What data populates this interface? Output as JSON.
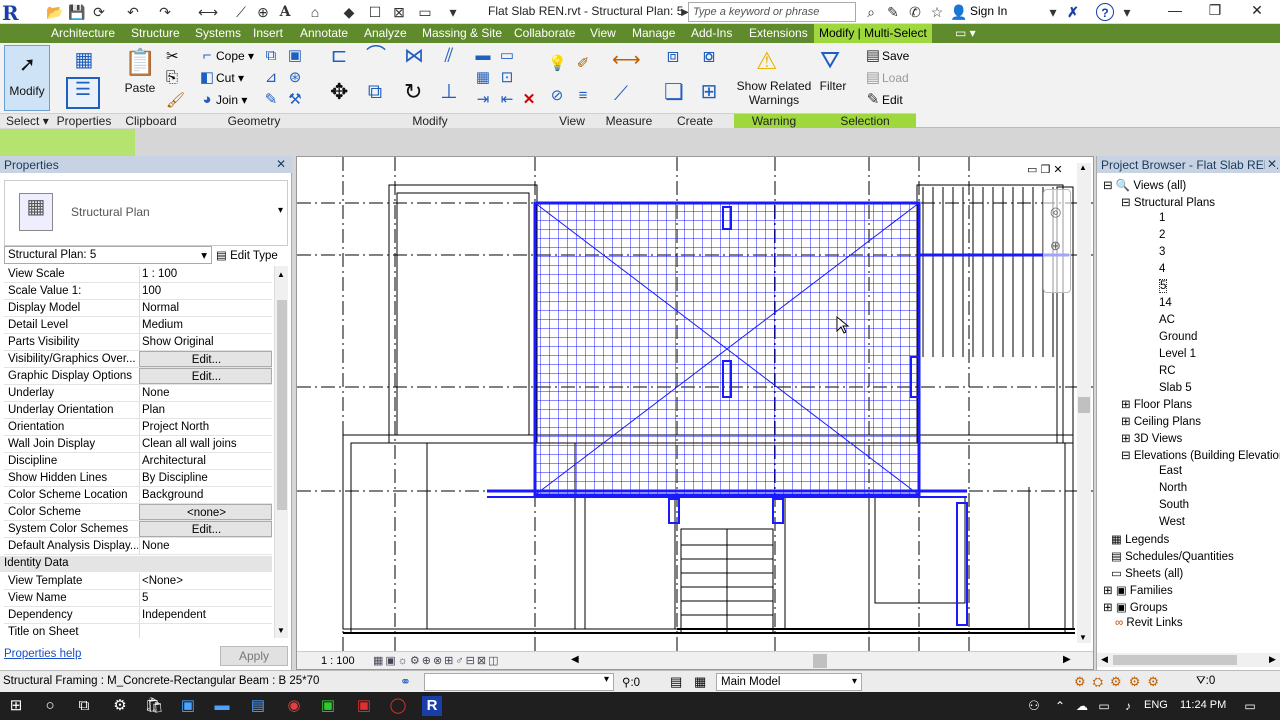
{
  "titlebar": {
    "logo": "R",
    "doc_title": "Flat Slab REN.rvt - Structural Plan: 5",
    "search_placeholder": "Type a keyword or phrase",
    "signin": "Sign In",
    "minimize": "—",
    "restore": "❐",
    "close": "✕",
    "help": "?"
  },
  "tabs": [
    "Architecture",
    "Structure",
    "Systems",
    "Insert",
    "Annotate",
    "Analyze",
    "Massing & Site",
    "Collaborate",
    "View",
    "Manage",
    "Add-Ins",
    "Extensions",
    "Modify | Multi-Select"
  ],
  "ribbon": {
    "modify": "Modify",
    "paste": "Paste",
    "cope": "Cope",
    "cut": "Cut",
    "join": "Join",
    "show_related": "Show Related",
    "warnings": "Warnings",
    "filter": "Filter",
    "save": "Save",
    "load": "Load",
    "edit": "Edit",
    "panels": {
      "select": "Select",
      "properties": "Properties",
      "clipboard": "Clipboard",
      "geometry": "Geometry",
      "modify": "Modify",
      "view": "View",
      "measure": "Measure",
      "create": "Create",
      "warning": "Warning",
      "selection": "Selection"
    }
  },
  "properties": {
    "header": "Properties",
    "type_name": "Structural Plan",
    "instance_selector": "Structural Plan: 5",
    "edit_type": "Edit Type",
    "rows": [
      {
        "k": "View Scale",
        "v": "1 : 100"
      },
      {
        "k": "Scale Value    1:",
        "v": "100"
      },
      {
        "k": "Display Model",
        "v": "Normal"
      },
      {
        "k": "Detail Level",
        "v": "Medium"
      },
      {
        "k": "Parts Visibility",
        "v": "Show Original"
      },
      {
        "k": "Visibility/Graphics Over...",
        "v": "Edit..."
      },
      {
        "k": "Graphic Display Options",
        "v": "Edit..."
      },
      {
        "k": "Underlay",
        "v": "None"
      },
      {
        "k": "Underlay Orientation",
        "v": "Plan"
      },
      {
        "k": "Orientation",
        "v": "Project North"
      },
      {
        "k": "Wall Join Display",
        "v": "Clean all wall joins"
      },
      {
        "k": "Discipline",
        "v": "Architectural"
      },
      {
        "k": "Show Hidden Lines",
        "v": "By Discipline"
      },
      {
        "k": "Color Scheme Location",
        "v": "Background"
      },
      {
        "k": "Color Scheme",
        "v": "<none>"
      },
      {
        "k": "System Color Schemes",
        "v": "Edit..."
      },
      {
        "k": "Default Analysis Display...",
        "v": "None"
      }
    ],
    "identity_header": "Identity Data",
    "identity_rows": [
      {
        "k": "View Template",
        "v": "<None>"
      },
      {
        "k": "View Name",
        "v": "5"
      },
      {
        "k": "Dependency",
        "v": "Independent"
      },
      {
        "k": "Title on Sheet",
        "v": ""
      }
    ],
    "help": "Properties help",
    "apply": "Apply"
  },
  "view": {
    "scale": "1 : 100"
  },
  "browser": {
    "header": "Project Browser - Flat Slab REN....",
    "views_all": "Views (all)",
    "structural_plans": "Structural Plans",
    "plans": [
      "1",
      "2",
      "3",
      "4",
      "5",
      "14",
      "AC",
      "Ground",
      "Level 1",
      "RC",
      "Slab 5"
    ],
    "floor_plans": "Floor Plans",
    "ceiling_plans": "Ceiling Plans",
    "views_3d": "3D Views",
    "elevations": "Elevations (Building Elevation)",
    "elev_items": [
      "East",
      "North",
      "South",
      "West"
    ],
    "others": [
      "Legends",
      "Schedules/Quantities",
      "Sheets (all)",
      "Families",
      "Groups",
      "Revit Links"
    ]
  },
  "status": {
    "text": "Structural Framing : M_Concrete-Rectangular Beam : B 25*70",
    "zero1": ":0",
    "model": "Main Model",
    "zero2": ":0"
  },
  "taskbar": {
    "lang": "ENG",
    "time": "11:24 PM"
  },
  "colors": {
    "tab_bar": "#5f8b2c",
    "tab_active": "#9ed83d",
    "selection_blue": "#1a1aff"
  }
}
